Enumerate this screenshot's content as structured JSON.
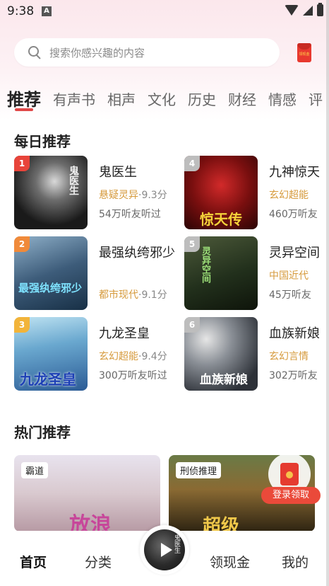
{
  "status_bar": {
    "time": "9:38",
    "notification_glyph": "A"
  },
  "search": {
    "placeholder": "搜索你感兴趣的内容"
  },
  "header": {
    "redpacket_text": "领现金"
  },
  "tabs": [
    "推荐",
    "有声书",
    "相声",
    "文化",
    "历史",
    "财经",
    "情感",
    "评"
  ],
  "daily": {
    "title": "每日推荐",
    "books": [
      {
        "rank": "1",
        "title": "鬼医生",
        "genre": "悬疑灵异",
        "score": "·9.3分",
        "listens": "54万听友听过",
        "cover_text": "鬼医生",
        "rank_color": "#e8443a"
      },
      {
        "rank": "2",
        "title": "最强纨绔邪少",
        "genre": "都市现代",
        "score": "·9.1分",
        "listens": "",
        "cover_text": "最强纨绔邪少",
        "rank_color": "#f08a3a"
      },
      {
        "rank": "3",
        "title": "九龙圣皇",
        "genre": "玄幻超能",
        "score": "·9.4分",
        "listens": "300万听友听过",
        "cover_text": "九龙圣皇",
        "rank_color": "#f2b43a"
      },
      {
        "rank": "4",
        "title": "九神惊天",
        "genre": "玄幻超能",
        "score": "",
        "listens": "460万听友",
        "cover_text": "惊天传",
        "rank_color": "#bdbdbd"
      },
      {
        "rank": "5",
        "title": "灵异空间",
        "genre": "中国近代",
        "score": "",
        "listens": "45万听友",
        "cover_text": "灵异空间",
        "rank_color": "#bdbdbd"
      },
      {
        "rank": "6",
        "title": "血族新娘",
        "genre": "玄幻言情",
        "score": "",
        "listens": "302万听友",
        "cover_text": "血族新娘",
        "rank_color": "#bdbdbd"
      }
    ]
  },
  "hot": {
    "title": "热门推荐",
    "cards": [
      {
        "tag": "霸道",
        "cover_text": "放浪"
      },
      {
        "tag": "刑侦推理",
        "cover_text": "超级"
      }
    ]
  },
  "float_promo": {
    "label": "登录领取"
  },
  "bottom_nav": {
    "home": "首页",
    "category": "分类",
    "player_text": "鬼医生",
    "cash": "领现金",
    "mine": "我的"
  }
}
